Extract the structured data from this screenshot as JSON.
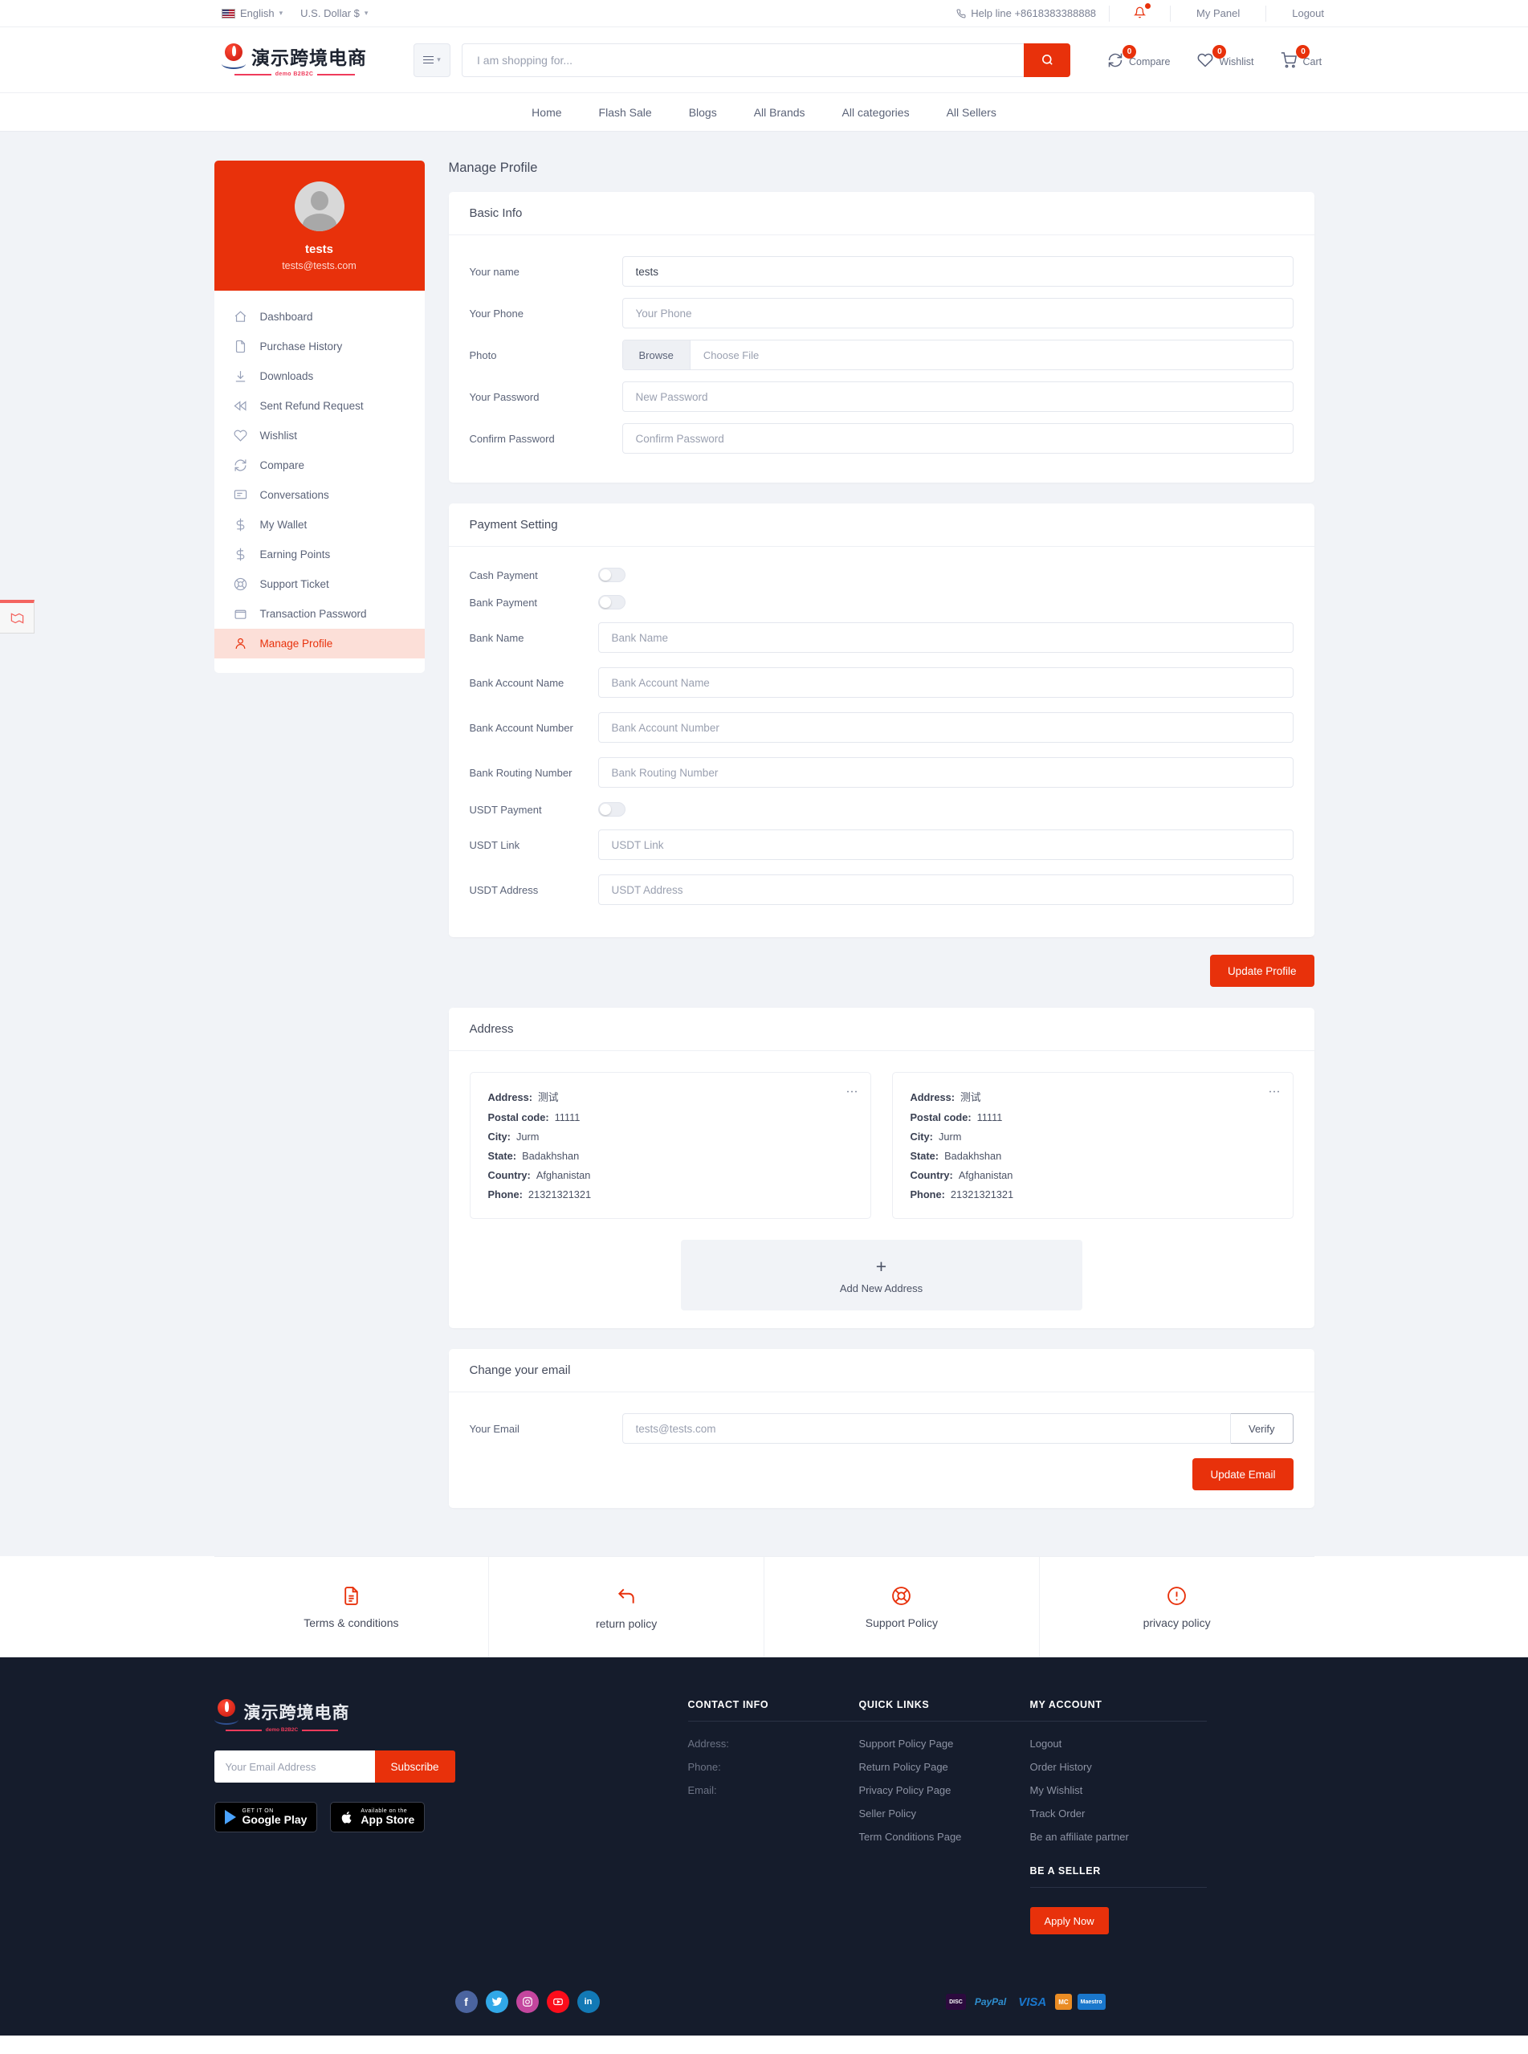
{
  "topbar": {
    "language": "English",
    "currency": "U.S. Dollar $",
    "helpline": "Help line +8618383388888",
    "my_panel": "My Panel",
    "logout": "Logout"
  },
  "header": {
    "logo_text": "演示跨境电商",
    "logo_tagline": "demo B2B2C",
    "search_placeholder": "I am shopping for...",
    "search_value": "",
    "actions": [
      {
        "label": "Compare",
        "count": "0",
        "icon": "compare-icon"
      },
      {
        "label": "Wishlist",
        "count": "0",
        "icon": "heart-icon"
      },
      {
        "label": "Cart",
        "count": "0",
        "icon": "cart-icon"
      }
    ]
  },
  "nav": {
    "items": [
      "Home",
      "Flash Sale",
      "Blogs",
      "All Brands",
      "All categories",
      "All Sellers"
    ]
  },
  "sidebar": {
    "user_name": "tests",
    "user_email": "tests@tests.com",
    "items": [
      {
        "label": "Dashboard",
        "icon": "home-icon",
        "active": false
      },
      {
        "label": "Purchase History",
        "icon": "file-icon",
        "active": false
      },
      {
        "label": "Downloads",
        "icon": "download-icon",
        "active": false
      },
      {
        "label": "Sent Refund Request",
        "icon": "rewind-icon",
        "active": false
      },
      {
        "label": "Wishlist",
        "icon": "heart-icon",
        "active": false
      },
      {
        "label": "Compare",
        "icon": "compare-icon",
        "active": false
      },
      {
        "label": "Conversations",
        "icon": "message-icon",
        "active": false
      },
      {
        "label": "My Wallet",
        "icon": "dollar-icon",
        "active": false
      },
      {
        "label": "Earning Points",
        "icon": "dollar-icon",
        "active": false
      },
      {
        "label": "Support Ticket",
        "icon": "lifebuoy-icon",
        "active": false
      },
      {
        "label": "Transaction Password",
        "icon": "wallet-icon",
        "active": false
      },
      {
        "label": "Manage Profile",
        "icon": "user-icon",
        "active": true
      }
    ]
  },
  "main": {
    "page_title": "Manage Profile",
    "basic_info": {
      "title": "Basic Info",
      "fields": [
        {
          "label": "Your name",
          "value": "tests",
          "placeholder": ""
        },
        {
          "label": "Your Phone",
          "value": "",
          "placeholder": "Your Phone"
        },
        {
          "label": "Your Password",
          "value": "",
          "placeholder": "New Password"
        },
        {
          "label": "Confirm Password",
          "value": "",
          "placeholder": "Confirm Password"
        }
      ],
      "photo_label": "Photo",
      "browse_label": "Browse",
      "choose_file_label": "Choose File"
    },
    "payment_setting": {
      "title": "Payment Setting",
      "toggles": [
        {
          "label": "Cash Payment",
          "on": false
        },
        {
          "label": "Bank Payment",
          "on": false
        }
      ],
      "bank_fields": [
        {
          "label": "Bank Name",
          "value": "",
          "placeholder": "Bank Name"
        },
        {
          "label": "Bank Account Name",
          "value": "",
          "placeholder": "Bank Account Name"
        },
        {
          "label": "Bank Account Number",
          "value": "",
          "placeholder": "Bank Account Number"
        },
        {
          "label": "Bank Routing Number",
          "value": "",
          "placeholder": "Bank Routing Number"
        }
      ],
      "usdt_toggle": {
        "label": "USDT Payment",
        "on": false
      },
      "usdt_fields": [
        {
          "label": "USDT Link",
          "value": "",
          "placeholder": "USDT Link"
        },
        {
          "label": "USDT Address",
          "value": "",
          "placeholder": "USDT Address"
        }
      ]
    },
    "update_profile_label": "Update Profile",
    "address": {
      "title": "Address",
      "labels": {
        "address": "Address:",
        "postal": "Postal code:",
        "city": "City:",
        "state": "State:",
        "country": "Country:",
        "phone": "Phone:"
      },
      "cards": [
        {
          "address": "测试",
          "postal_code": "11111",
          "city": "Jurm",
          "state": "Badakhshan",
          "country": "Afghanistan",
          "phone": "21321321321"
        },
        {
          "address": "测试",
          "postal_code": "11111",
          "city": "Jurm",
          "state": "Badakhshan",
          "country": "Afghanistan",
          "phone": "21321321321"
        }
      ],
      "add_new_label": "Add New Address",
      "add_new_icon": "plus-icon"
    },
    "change_email": {
      "title": "Change your email",
      "label": "Your Email",
      "value": "tests@tests.com",
      "placeholder": "tests@tests.com",
      "verify_label": "Verify",
      "update_label": "Update Email"
    }
  },
  "policies": [
    {
      "label": "Terms & conditions",
      "icon": "document-icon"
    },
    {
      "label": "return policy",
      "icon": "return-arrow-icon"
    },
    {
      "label": "Support Policy",
      "icon": "lifebuoy-icon"
    },
    {
      "label": "privacy policy",
      "icon": "alert-circle-icon"
    }
  ],
  "footer": {
    "logo_text": "演示跨境电商",
    "logo_tagline": "demo B2B2C",
    "subscribe_placeholder": "Your Email Address",
    "subscribe_value": "",
    "subscribe_label": "Subscribe",
    "google_play": {
      "small": "GET IT ON",
      "big": "Google Play"
    },
    "app_store": {
      "small": "Available on the",
      "big": "App Store"
    },
    "contact_info": {
      "title": "CONTACT INFO",
      "rows": [
        "Address:",
        "Phone:",
        "Email:"
      ]
    },
    "quick_links": {
      "title": "QUICK LINKS",
      "items": [
        "Support Policy Page",
        "Return Policy Page",
        "Privacy Policy Page",
        "Seller Policy",
        "Term Conditions Page"
      ]
    },
    "my_account": {
      "title": "MY ACCOUNT",
      "items": [
        "Logout",
        "Order History",
        "My Wishlist",
        "Track Order",
        "Be an affiliate partner"
      ]
    },
    "be_a_seller": {
      "title": "BE A SELLER",
      "apply_label": "Apply Now"
    },
    "socials": [
      {
        "name": "facebook-icon",
        "glyph": "f",
        "color": "#4b649f"
      },
      {
        "name": "twitter-icon",
        "glyph": "t",
        "color": "#31a8e8"
      },
      {
        "name": "instagram-icon",
        "glyph": "o",
        "color": "#c4469e"
      },
      {
        "name": "youtube-icon",
        "glyph": "y",
        "color": "#fc0d1b"
      },
      {
        "name": "linkedin-icon",
        "glyph": "in",
        "color": "#1279b5"
      }
    ],
    "payments": [
      {
        "name": "discover-icon",
        "text": "DISC",
        "bg": "#2b0a3d",
        "fg": "#ffffff"
      },
      {
        "name": "paypal-icon",
        "text": "PayPal",
        "bg": "#151c2c",
        "fg": "#2f8fd0"
      },
      {
        "name": "visa-icon",
        "text": "VISA",
        "bg": "#151c2c",
        "fg": "#1a77cc"
      },
      {
        "name": "mastercard-icon",
        "text": "MC",
        "bg": "#ea8c24",
        "fg": "#ffffff"
      },
      {
        "name": "maestro-icon",
        "text": "Maestro",
        "bg": "#1a77cc",
        "fg": "#ffffff"
      }
    ]
  },
  "colors": {
    "accent": "#e8310b",
    "page_bg": "#f1f3f7",
    "footer_bg": "#151c2c"
  }
}
